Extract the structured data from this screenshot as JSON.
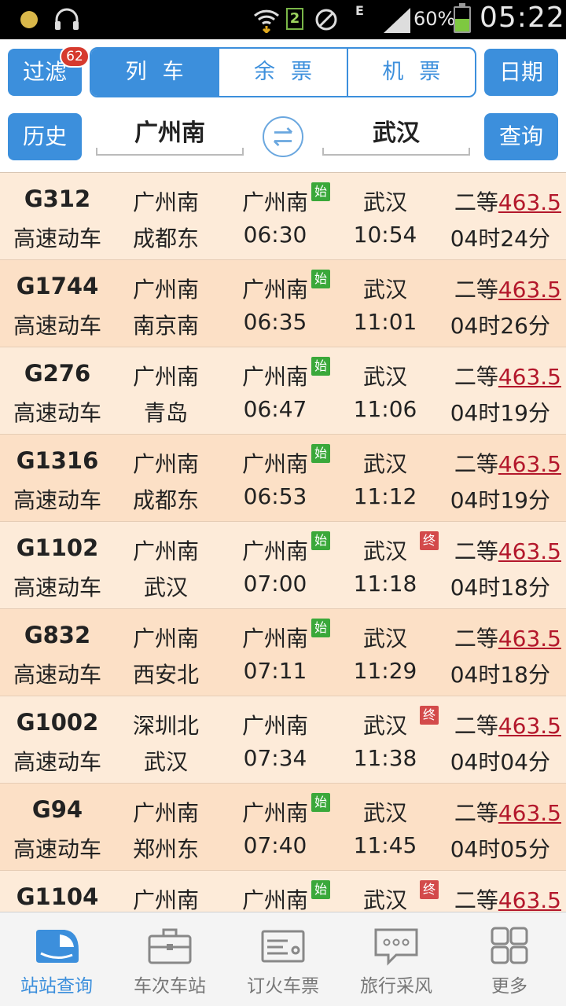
{
  "statusbar": {
    "sim": "2",
    "network": "E",
    "battery": "60%",
    "time": "05:22"
  },
  "header": {
    "filter_label": "过滤",
    "filter_badge": "62",
    "tabs": [
      {
        "label": "列车",
        "active": true
      },
      {
        "label": "余票",
        "active": false
      },
      {
        "label": "机票",
        "active": false
      }
    ],
    "date_label": "日期",
    "history_label": "历史",
    "from_station": "广州南",
    "to_station": "武汉",
    "query_label": "查询"
  },
  "tags": {
    "start": "始",
    "end": "终"
  },
  "trains": [
    {
      "train": "G312",
      "type": "高速动车",
      "origin": "广州南",
      "terminal": "成都东",
      "dep_station": "广州南",
      "dep_time": "06:30",
      "arr_station": "武汉",
      "arr_time": "10:54",
      "seat": "二等",
      "price": "463.5",
      "duration": "04时24分",
      "start_tag": true,
      "end_tag": false
    },
    {
      "train": "G1744",
      "type": "高速动车",
      "origin": "广州南",
      "terminal": "南京南",
      "dep_station": "广州南",
      "dep_time": "06:35",
      "arr_station": "武汉",
      "arr_time": "11:01",
      "seat": "二等",
      "price": "463.5",
      "duration": "04时26分",
      "start_tag": true,
      "end_tag": false
    },
    {
      "train": "G276",
      "type": "高速动车",
      "origin": "广州南",
      "terminal": "青岛",
      "dep_station": "广州南",
      "dep_time": "06:47",
      "arr_station": "武汉",
      "arr_time": "11:06",
      "seat": "二等",
      "price": "463.5",
      "duration": "04时19分",
      "start_tag": true,
      "end_tag": false
    },
    {
      "train": "G1316",
      "type": "高速动车",
      "origin": "广州南",
      "terminal": "成都东",
      "dep_station": "广州南",
      "dep_time": "06:53",
      "arr_station": "武汉",
      "arr_time": "11:12",
      "seat": "二等",
      "price": "463.5",
      "duration": "04时19分",
      "start_tag": true,
      "end_tag": false
    },
    {
      "train": "G1102",
      "type": "高速动车",
      "origin": "广州南",
      "terminal": "武汉",
      "dep_station": "广州南",
      "dep_time": "07:00",
      "arr_station": "武汉",
      "arr_time": "11:18",
      "seat": "二等",
      "price": "463.5",
      "duration": "04时18分",
      "start_tag": true,
      "end_tag": true
    },
    {
      "train": "G832",
      "type": "高速动车",
      "origin": "广州南",
      "terminal": "西安北",
      "dep_station": "广州南",
      "dep_time": "07:11",
      "arr_station": "武汉",
      "arr_time": "11:29",
      "seat": "二等",
      "price": "463.5",
      "duration": "04时18分",
      "start_tag": true,
      "end_tag": false
    },
    {
      "train": "G1002",
      "type": "高速动车",
      "origin": "深圳北",
      "terminal": "武汉",
      "dep_station": "广州南",
      "dep_time": "07:34",
      "arr_station": "武汉",
      "arr_time": "11:38",
      "seat": "二等",
      "price": "463.5",
      "duration": "04时04分",
      "start_tag": false,
      "end_tag": true
    },
    {
      "train": "G94",
      "type": "高速动车",
      "origin": "广州南",
      "terminal": "郑州东",
      "dep_station": "广州南",
      "dep_time": "07:40",
      "arr_station": "武汉",
      "arr_time": "11:45",
      "seat": "二等",
      "price": "463.5",
      "duration": "04时05分",
      "start_tag": true,
      "end_tag": false
    },
    {
      "train": "G1104",
      "type": "",
      "origin": "广州南",
      "terminal": "",
      "dep_station": "广州南",
      "dep_time": "",
      "arr_station": "武汉",
      "arr_time": "",
      "seat": "二等",
      "price": "463.5",
      "duration": "",
      "start_tag": true,
      "end_tag": true
    }
  ],
  "bottomnav": [
    {
      "label": "站站查询",
      "icon": "train-icon",
      "active": true
    },
    {
      "label": "车次车站",
      "icon": "briefcase-icon",
      "active": false
    },
    {
      "label": "订火车票",
      "icon": "ticket-icon",
      "active": false
    },
    {
      "label": "旅行采风",
      "icon": "chat-bubble-icon",
      "active": false
    },
    {
      "label": "更多",
      "icon": "grid-icon",
      "active": false
    }
  ]
}
